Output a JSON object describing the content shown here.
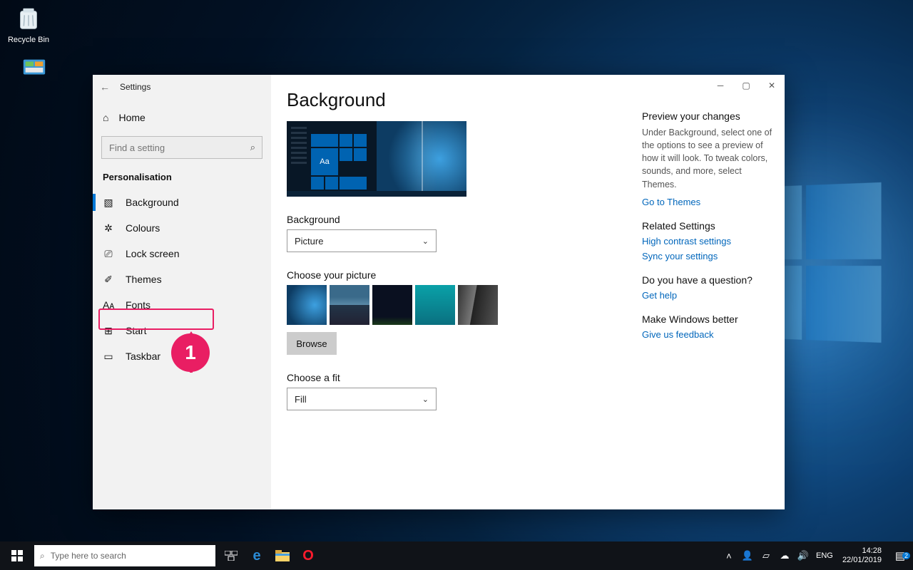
{
  "desktop": {
    "recycle_label": "Recycle Bin"
  },
  "window": {
    "title": "Settings",
    "controls": {
      "min": "─",
      "max": "▢",
      "close": "✕"
    }
  },
  "sidebar": {
    "home_label": "Home",
    "search_placeholder": "Find a setting",
    "section": "Personalisation",
    "items": [
      {
        "icon": "▧",
        "label": "Background"
      },
      {
        "icon": "✲",
        "label": "Colours"
      },
      {
        "icon": "⎚",
        "label": "Lock screen"
      },
      {
        "icon": "✐",
        "label": "Themes"
      },
      {
        "icon": "Aᴀ",
        "label": "Fonts"
      },
      {
        "icon": "⊞",
        "label": "Start"
      },
      {
        "icon": "▭",
        "label": "Taskbar"
      }
    ]
  },
  "main": {
    "title": "Background",
    "preview_sample": "Aa",
    "bg_label": "Background",
    "bg_value": "Picture",
    "choose_pic_label": "Choose your picture",
    "browse_label": "Browse",
    "fit_label": "Choose a fit",
    "fit_value": "Fill"
  },
  "right": {
    "preview_head": "Preview your changes",
    "preview_text": "Under Background, select one of the options to see a preview of how it will look. To tweak colors, sounds, and more, select Themes.",
    "themes_link": "Go to Themes",
    "related_head": "Related Settings",
    "hc_link": "High contrast settings",
    "sync_link": "Sync your settings",
    "question_head": "Do you have a question?",
    "help_link": "Get help",
    "better_head": "Make Windows better",
    "feedback_link": "Give us feedback"
  },
  "annotation": {
    "badge": "1"
  },
  "taskbar": {
    "search_placeholder": "Type here to search",
    "lang": "ENG",
    "time": "14:28",
    "date": "22/01/2019",
    "notif_count": "2"
  }
}
